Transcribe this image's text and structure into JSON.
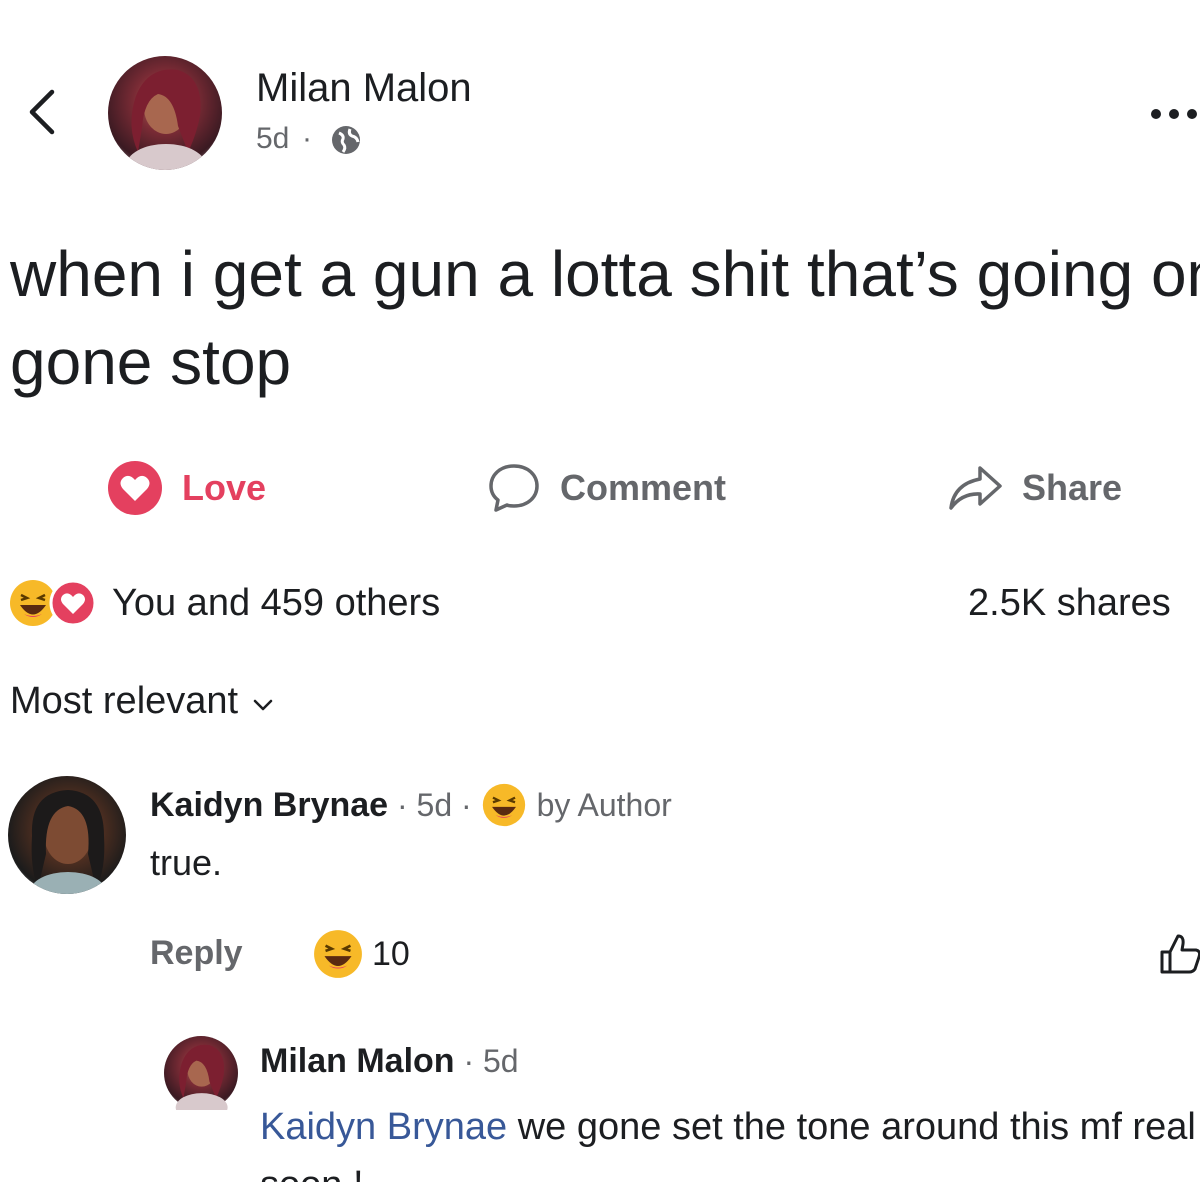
{
  "header": {
    "author": "Milan Malon",
    "time": "5d",
    "separator": "·"
  },
  "post": {
    "text": "when i get a gun a lotta shit that’s going on gone stop"
  },
  "actions": {
    "love": "Love",
    "comment": "Comment",
    "share": "Share"
  },
  "summary": {
    "reactions_text": "You and 459 others",
    "shares_text": "2.5K shares"
  },
  "comments": {
    "filter": "Most relevant",
    "items": [
      {
        "author": "Kaidyn Brynae",
        "time": "5d",
        "badge": "by Author",
        "text": "true.",
        "reply_label": "Reply",
        "reaction_count": "10",
        "replies": [
          {
            "author": "Milan Malon",
            "time": "5d",
            "mention": "Kaidyn Brynae",
            "text": " we gone set the tone around this mf real soon !"
          }
        ]
      }
    ]
  },
  "colors": {
    "love": "#e4405f",
    "haha": "#f7b928",
    "mention": "#385898",
    "secondary_text": "#65676b"
  }
}
